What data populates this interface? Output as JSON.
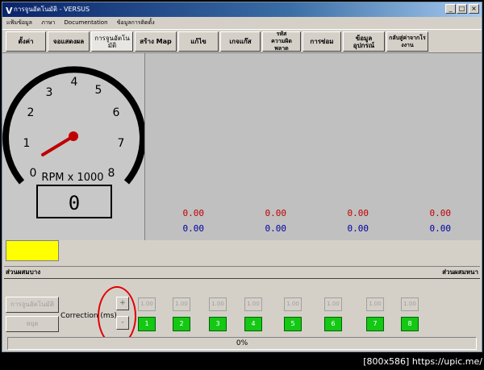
{
  "window": {
    "title": "การจูนอัตโนมัติ - VERSUS",
    "app_icon": "V"
  },
  "menu": [
    "แฟ้มข้อมูล",
    "ภาษา",
    "Documentation",
    "ข้อมูลการติดตั้ง"
  ],
  "tabs": [
    {
      "label": "ตั้งค่า"
    },
    {
      "label": "จอแสดงผล"
    },
    {
      "label": "การจูนอัตโนมัติ"
    },
    {
      "label": "สร้าง Map"
    },
    {
      "label": "แก้ไข"
    },
    {
      "label": "เกจแก๊ส"
    },
    {
      "label": "รหัส\nความผิดพลาด"
    },
    {
      "label": "การซ่อม"
    },
    {
      "label": "ข้อมูลอุปกรณ์"
    },
    {
      "label": "กลับสู่ค่าจากโร\nงงาน"
    }
  ],
  "gauge": {
    "ticks": [
      "0",
      "1",
      "2",
      "3",
      "4",
      "5",
      "6",
      "7",
      "8"
    ],
    "unit_label": "RPM x 1000",
    "digital_value": "0",
    "value_rpm_thousands": 0
  },
  "values": {
    "red": [
      "0.00",
      "0.00",
      "0.00",
      "0.00"
    ],
    "blue": [
      "0.00",
      "0.00",
      "0.00",
      "0.00"
    ]
  },
  "mix": {
    "left": "ส่วนผสมบาง",
    "right": "ส่วนผสมหนา"
  },
  "buttons": {
    "autotune": "การจูนอัตโนมัติ",
    "stop": "หยุด"
  },
  "correction": {
    "label": "Correction (ms)",
    "plus": "+",
    "minus": "-",
    "values": [
      "1.00",
      "1.00",
      "1.00",
      "1.00",
      "1.00",
      "1.00",
      "1.00",
      "1.00"
    ],
    "cylinders": [
      "1",
      "2",
      "3",
      "4",
      "5",
      "6",
      "7",
      "8"
    ]
  },
  "progress": {
    "text": "0%",
    "value": 0
  },
  "watermark": "[800x586] https://upic.me/",
  "colors": {
    "titlebar": "#0a246a",
    "yellow_indicator": "#ffff00",
    "cylinder_active": "#14c814",
    "annotation": "#e00000",
    "gauge_needle": "#c00000"
  }
}
